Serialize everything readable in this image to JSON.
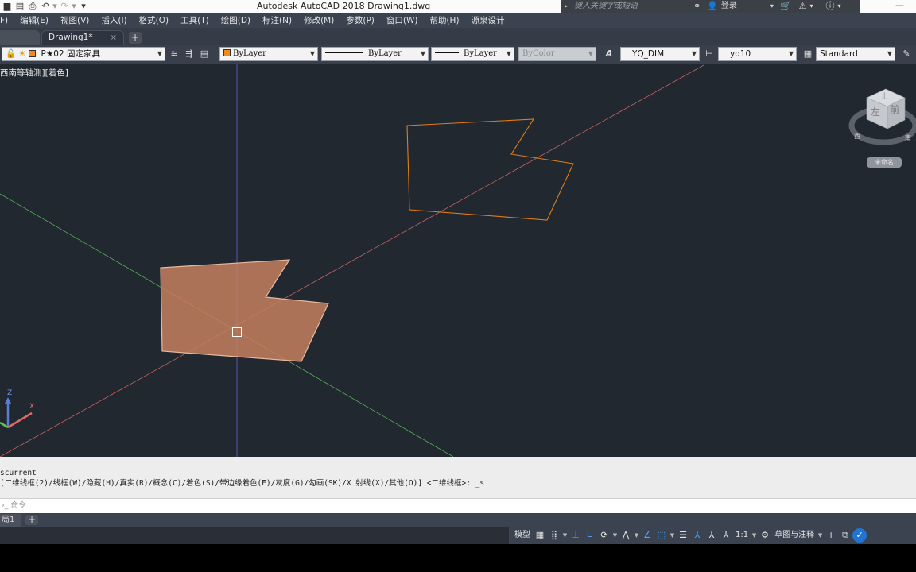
{
  "titlebar": {
    "title": "Autodesk AutoCAD 2018    Drawing1.dwg",
    "search_placeholder": "键入关键字或短语",
    "login": "登录",
    "icons": [
      "save-icon",
      "save-as-icon",
      "plot-icon",
      "undo-icon",
      "redo-icon",
      "binoculars-icon",
      "user-icon",
      "cart-icon",
      "exchange-icon",
      "help-icon",
      "minimize-icon"
    ]
  },
  "menubar": {
    "items": [
      "F)",
      "编辑(E)",
      "视图(V)",
      "插入(I)",
      "格式(O)",
      "工具(T)",
      "绘图(D)",
      "标注(N)",
      "修改(M)",
      "参数(P)",
      "窗口(W)",
      "帮助(H)",
      "源泉设计"
    ]
  },
  "tabs": {
    "active": "Drawing1*",
    "close": "×",
    "add": "+"
  },
  "properties": {
    "layer": "P★02 固定家具",
    "color": "ByLayer",
    "linetype": "ByLayer",
    "lineweight": "ByLayer",
    "plotstyle": "ByColor",
    "dimstyle": "YQ_DIM",
    "tablestyle": "yq10",
    "mleaderstyle": "Standard",
    "accent_color": "#f08a1c"
  },
  "viewport": {
    "label": "西南等轴测][着色]",
    "viewcube": {
      "top": "上",
      "left": "左",
      "front": "前",
      "south": "南",
      "west": "西",
      "unnamed": "未命名"
    },
    "ucs": {
      "z": "Z",
      "x": "X"
    },
    "colors": {
      "background": "#212830",
      "x_axis": "#e06b6b",
      "y_axis": "#5fc25f",
      "z_axis": "#6a6ae0",
      "outline": "#e07d18",
      "fill": "#c47f5f"
    }
  },
  "command": {
    "history": [
      "scurrent",
      "[二维线框(2)/线框(W)/隐藏(H)/真实(R)/概念(C)/着色(S)/带边缘着色(E)/灰度(G)/勾画(SK)/X 射线(X)/其他(O)] <二维线框>: _s"
    ],
    "input_placeholder": "命令"
  },
  "layout": {
    "tab": "局1",
    "add": "+"
  },
  "status": {
    "model": "模型",
    "scale": "1:1",
    "workspace": "草图与注释"
  }
}
